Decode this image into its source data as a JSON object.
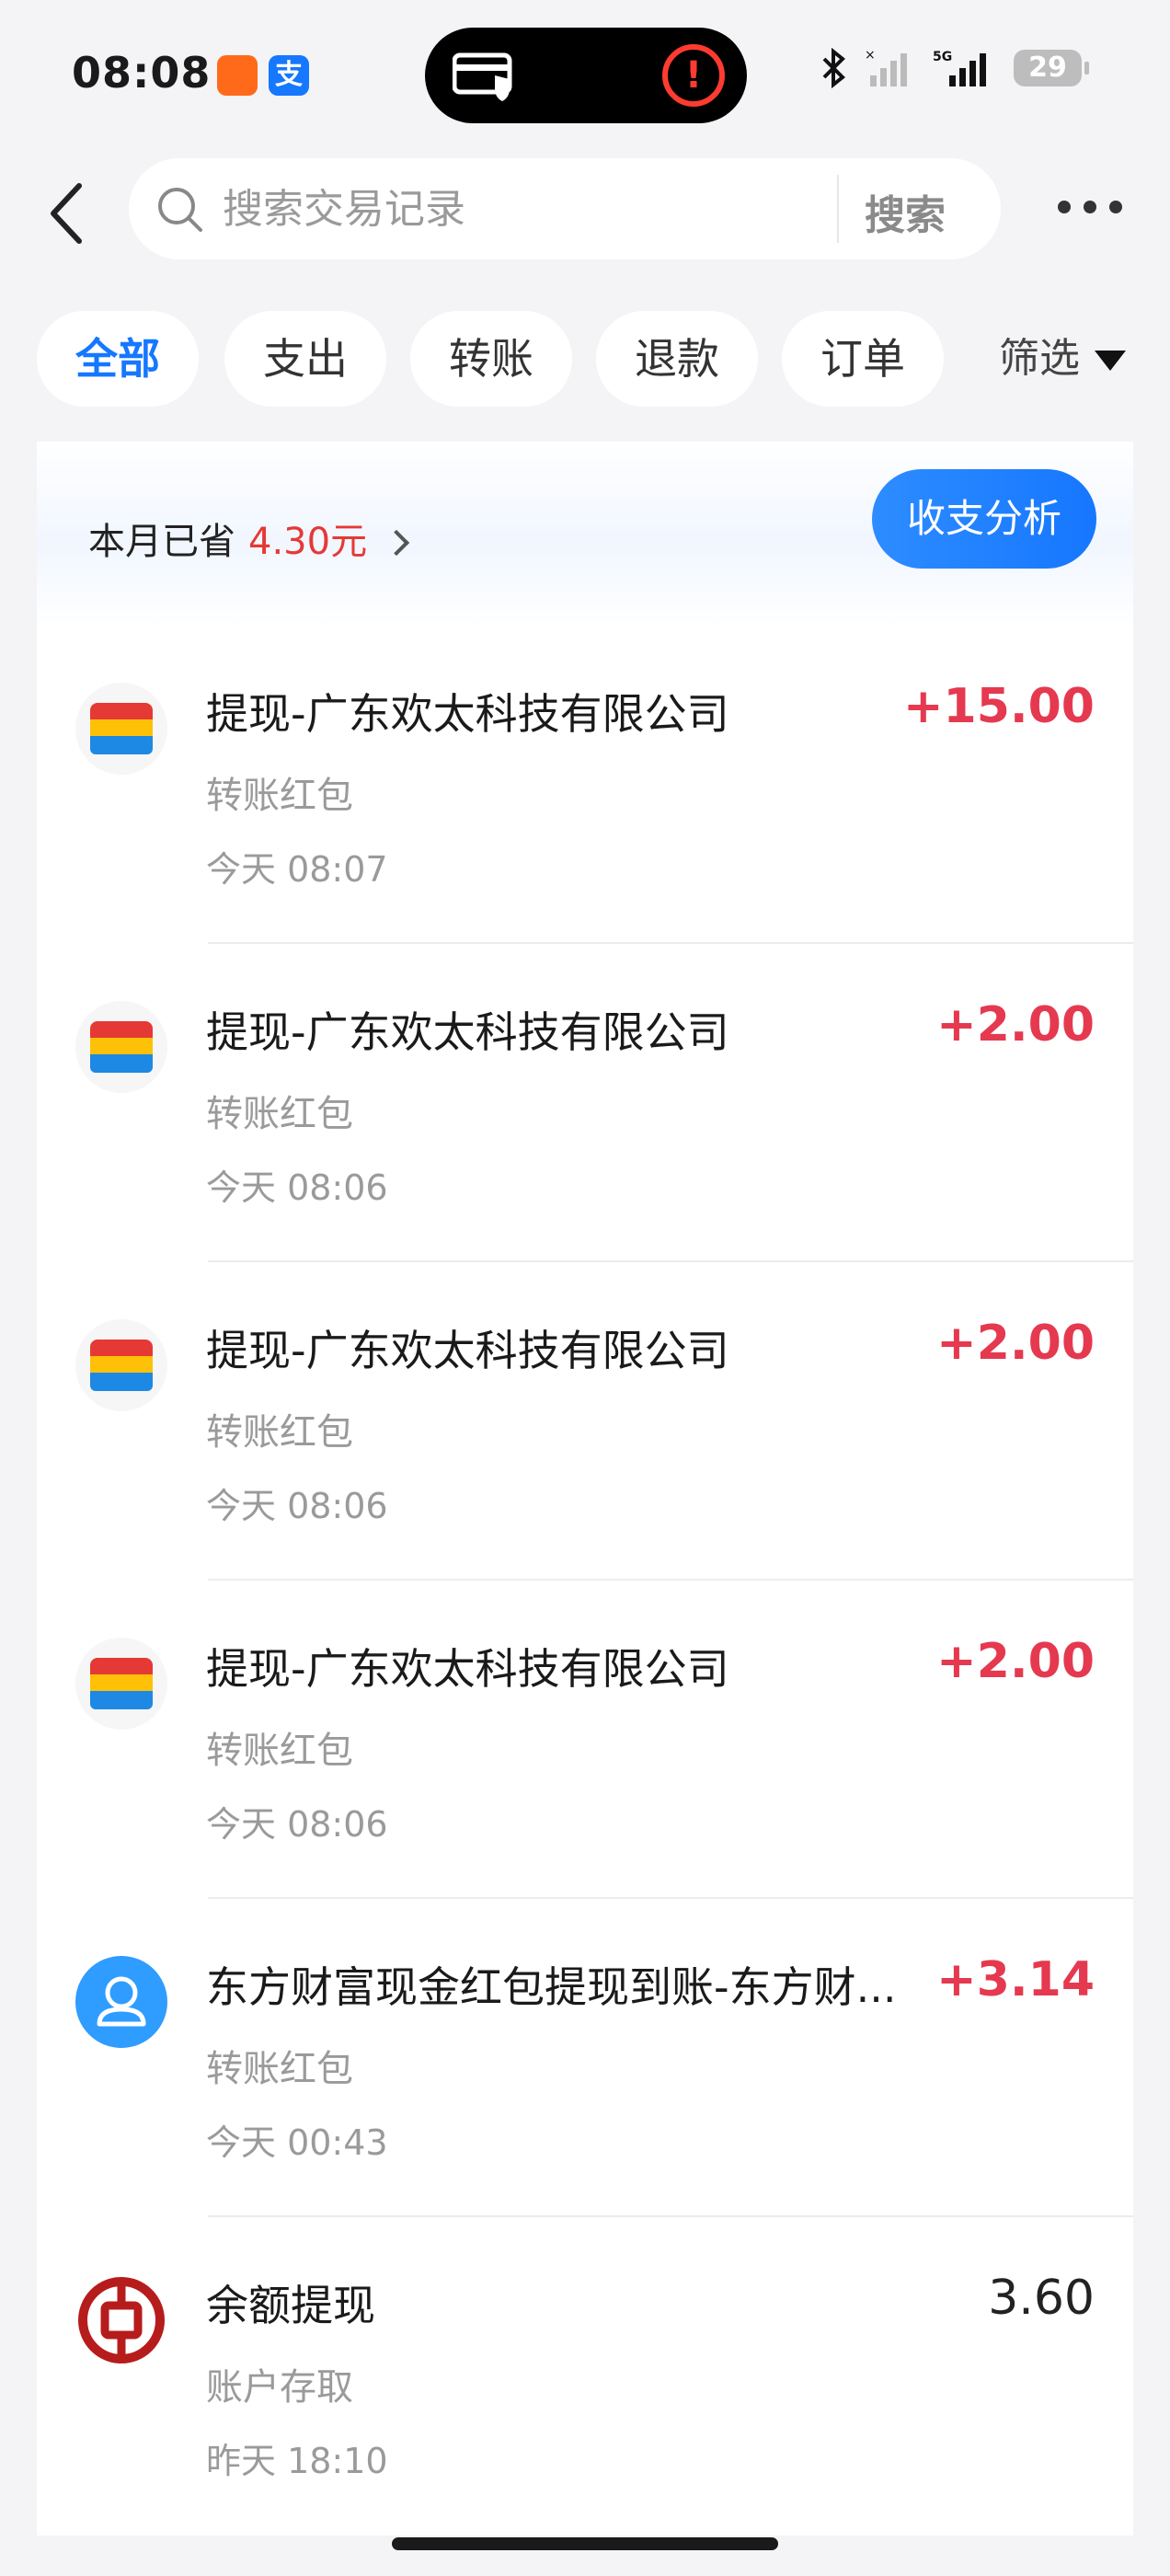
{
  "status_bar": {
    "time": "08:08",
    "battery": "29",
    "icons": [
      "taobao-app-icon",
      "alipay-app-icon",
      "bluetooth-icon",
      "signal-icon",
      "5g-signal-icon",
      "battery-icon"
    ]
  },
  "search": {
    "placeholder": "搜索交易记录",
    "button": "搜索"
  },
  "tabs": [
    {
      "label": "全部",
      "active": true
    },
    {
      "label": "支出"
    },
    {
      "label": "转账"
    },
    {
      "label": "退款"
    },
    {
      "label": "订单"
    }
  ],
  "filter_label": "筛选",
  "summary": {
    "saved_label": "本月已省",
    "saved_amount": "4.30元",
    "analysis_button": "收支分析"
  },
  "transactions": [
    {
      "title": "提现-广东欢太科技有限公司",
      "category": "转账红包",
      "time": "今天 08:07",
      "amount": "+15.00",
      "icon": "wallet-icon"
    },
    {
      "title": "提现-广东欢太科技有限公司",
      "category": "转账红包",
      "time": "今天 08:06",
      "amount": "+2.00",
      "icon": "wallet-icon"
    },
    {
      "title": "提现-广东欢太科技有限公司",
      "category": "转账红包",
      "time": "今天 08:06",
      "amount": "+2.00",
      "icon": "wallet-icon"
    },
    {
      "title": "提现-广东欢太科技有限公司",
      "category": "转账红包",
      "time": "今天 08:06",
      "amount": "+2.00",
      "icon": "wallet-icon"
    },
    {
      "title": "东方财富现金红包提现到账-东方财...",
      "category": "转账红包",
      "time": "今天 00:43",
      "amount": "+3.14",
      "icon": "person-icon"
    },
    {
      "title": "余额提现",
      "category": "账户存取",
      "time": "昨天 18:10",
      "amount": "3.60",
      "icon": "bank-icon"
    }
  ],
  "colors": {
    "accent": "#1677ff",
    "income": "#e53950",
    "saved": "#e53935"
  }
}
